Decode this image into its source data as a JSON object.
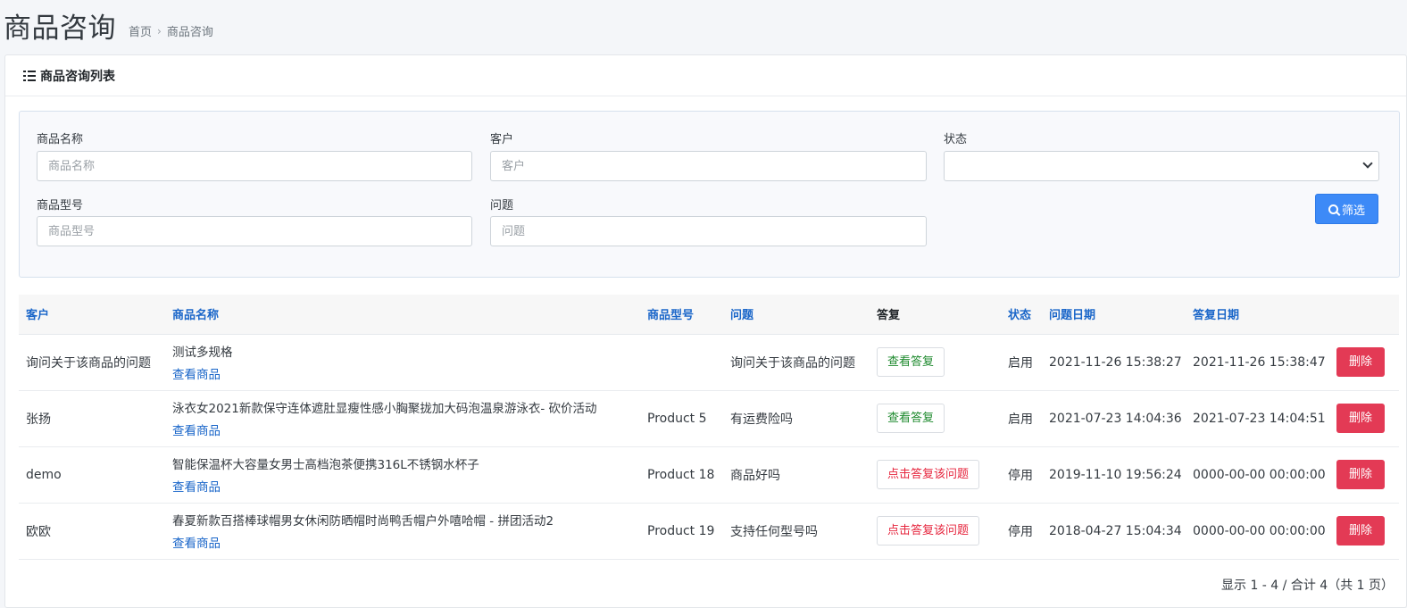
{
  "page": {
    "title": "商品咨询",
    "breadcrumb": {
      "home": "首页",
      "separator": "›",
      "current": "商品咨询"
    }
  },
  "card": {
    "title": "商品咨询列表",
    "icon": "list-icon"
  },
  "filters": {
    "product_name": {
      "label": "商品名称",
      "placeholder": "商品名称",
      "value": ""
    },
    "customer": {
      "label": "客户",
      "placeholder": "客户",
      "value": ""
    },
    "status": {
      "label": "状态",
      "value": ""
    },
    "model": {
      "label": "商品型号",
      "placeholder": "商品型号",
      "value": ""
    },
    "question": {
      "label": "问题",
      "placeholder": "问题",
      "value": ""
    },
    "button_label": "筛选"
  },
  "table": {
    "headers": {
      "customer": "客户",
      "product_name": "商品名称",
      "model": "商品型号",
      "question": "问题",
      "reply": "答复",
      "status": "状态",
      "question_date": "问题日期",
      "reply_date": "答复日期"
    },
    "rows": [
      {
        "customer": "询问关于该商品的问题",
        "product_name": "测试多规格",
        "view_link": "查看商品",
        "model": "",
        "question": "询问关于该商品的问题",
        "reply_label": "查看答复",
        "status": "启用",
        "question_date": "2021-11-26 15:38:27",
        "reply_date": "2021-11-26 15:38:47",
        "delete_label": "删除"
      },
      {
        "customer": "张扬",
        "product_name": "泳衣女2021新款保守连体遮肚显瘦性感小胸聚拢加大码泡温泉游泳衣- 砍价活动",
        "view_link": "查看商品",
        "model": "Product 5",
        "question": "有运费险吗",
        "reply_label": "查看答复",
        "status": "启用",
        "question_date": "2021-07-23 14:04:36",
        "reply_date": "2021-07-23 14:04:51",
        "delete_label": "删除"
      },
      {
        "customer": "demo",
        "product_name": "智能保温杯大容量女男士高档泡茶便携316L不锈钢水杯子",
        "view_link": "查看商品",
        "model": "Product 18",
        "question": "商品好吗",
        "reply_label": "点击答复该问题",
        "status": "停用",
        "question_date": "2019-11-10 19:56:24",
        "reply_date": "0000-00-00 00:00:00",
        "delete_label": "删除"
      },
      {
        "customer": "欧欧",
        "product_name": "春夏新款百搭棒球帽男女休闲防晒帽时尚鸭舌帽户外嘻哈帽 - 拼团活动2",
        "view_link": "查看商品",
        "model": "Product 19",
        "question": "支持任何型号吗",
        "reply_label": "点击答复该问题",
        "status": "停用",
        "question_date": "2018-04-27 15:04:34",
        "reply_date": "0000-00-00 00:00:00",
        "delete_label": "删除"
      }
    ]
  },
  "pagination": {
    "summary": "显示 1 - 4 / 合计 4（共 1 页）"
  },
  "colors": {
    "primary": "#3d8af7",
    "link": "#1a66c9",
    "danger": "#e33a55",
    "success_text": "#1e8a2e",
    "danger_text": "#e6263e"
  }
}
